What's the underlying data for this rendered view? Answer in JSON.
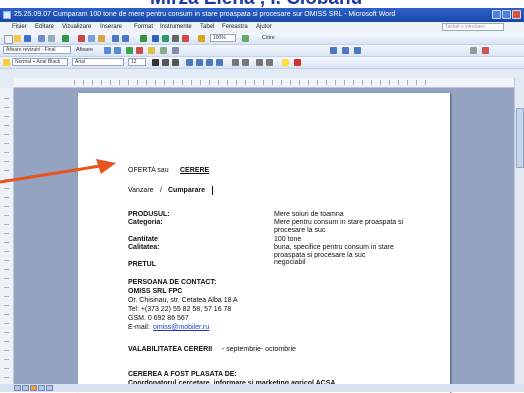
{
  "banner": {
    "text": "Mirza Elena , I. Ciobanu"
  },
  "window": {
    "title": "25.25.09.07 Cumparam 100 tone de mere pentru consum in stare proaspata si procesare sur OMISS SRL - Microsoft Word",
    "menu": [
      "Fisier",
      "Editare",
      "Vizualizare",
      "Inserare",
      "Format",
      "Instrumente",
      "Tabel",
      "Fereastra",
      "Ajutor"
    ],
    "help_placeholder": "Tastati o intrebare",
    "toolbar1": {
      "zoom": "100%",
      "reading": "Citire"
    },
    "toolbar2": {
      "tracking": "Afisare revizuiri - Final",
      "show": "Afisare"
    },
    "toolbar3": {
      "style": "Normal + Arial Black",
      "font": "Arial",
      "size": "12"
    }
  },
  "document": {
    "offer_label": "OFERTA sau",
    "offer_value": "CERERE",
    "transaction_label": "Vanzare",
    "transaction_sep": "/",
    "transaction_value": "Cumparare",
    "product_label": "PRODUSUL:",
    "product_value": "Mere soiuri de toamna",
    "category_label": "Categoria:",
    "category_value_1": "Mere pentru consum in stare proaspata si",
    "category_value_2": "procesare la suc",
    "quantity_label": "Cantitate",
    "quantity_value": "100 tone",
    "quality_label": "Calitatea:",
    "quality_value_1": "buna, specifice pentru consum in stare",
    "quality_value_2": "proaspata si procesare la suc",
    "price_label": "PRETUL",
    "price_value": "negociabil",
    "contact_heading": "PERSOANA DE CONTACT:",
    "company": "OMISS SRL FPC",
    "address": "Or. Chisinau, str. Cetatea Alba 18 A",
    "tel": "Tel: +(373 22) 55 82 58, 57 16 78",
    "gsm": "GSM. 0 692 86 567",
    "email_label": "E-mail:",
    "email_value": "omiss@mobiler.ru",
    "validity_label": "VALABILITATEA CERERII",
    "validity_value": "- septembrie- octombrie",
    "placed_heading": "CEREREA A FOST PLASATA DE:",
    "placed_by": "Coordonatorul cercetare, informare si marketing agricol ACSA"
  },
  "colors": {
    "banner_text": "#1f3aa6",
    "titlebar": "#1f4fb8",
    "arrow": "#e8531f",
    "doc_bg": "#94a3c0"
  }
}
